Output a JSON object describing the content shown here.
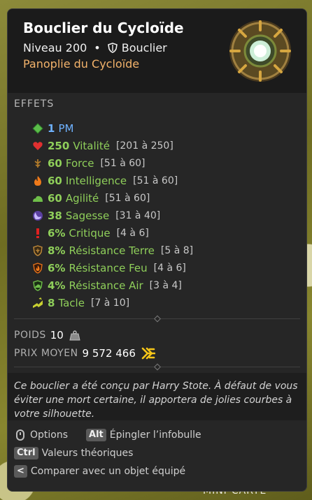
{
  "item": {
    "name": "Bouclier du Cycloïde",
    "level_text": "Niveau 200",
    "type": "Bouclier",
    "set": "Panoplie du Cycloïde"
  },
  "effects_title": "EFFETS",
  "effects": [
    {
      "icon": "pm-icon",
      "value": "1",
      "name": "PM",
      "range": ""
    },
    {
      "icon": "heart-icon",
      "value": "250",
      "name": "Vitalité",
      "range": "[201 à 250]"
    },
    {
      "icon": "force-icon",
      "value": "60",
      "name": "Force",
      "range": "[51 à 60]"
    },
    {
      "icon": "fire-icon",
      "value": "60",
      "name": "Intelligence",
      "range": "[51 à 60]"
    },
    {
      "icon": "agility-icon",
      "value": "60",
      "name": "Agilité",
      "range": "[51 à 60]"
    },
    {
      "icon": "wisdom-icon",
      "value": "38",
      "name": "Sagesse",
      "range": "[31 à 40]"
    },
    {
      "icon": "critical-icon",
      "value": "6%",
      "name": "Critique",
      "range": "[4 à 6]"
    },
    {
      "icon": "earth-resist-icon",
      "value": "8%",
      "name": "Résistance Terre",
      "range": "[5 à 8]"
    },
    {
      "icon": "fire-resist-icon",
      "value": "6%",
      "name": "Résistance Feu",
      "range": "[4 à 6]"
    },
    {
      "icon": "air-resist-icon",
      "value": "4%",
      "name": "Résistance Air",
      "range": "[3 à 4]"
    },
    {
      "icon": "tackle-icon",
      "value": "8",
      "name": "Tacle",
      "range": "[7 à 10]"
    }
  ],
  "weight": {
    "label": "POIDS",
    "value": "10"
  },
  "price": {
    "label": "PRIX MOYEN",
    "value": "9 572 466"
  },
  "description": "Ce bouclier a été conçu par Harry Stote. À défaut de vous éviter une mort certaine, il apportera de jolies courbes à votre silhouette.",
  "footer": {
    "options": "Options",
    "alt_key": "Alt",
    "pin": "Épingler l’infobulle",
    "ctrl_key": "Ctrl",
    "theoretical": "Valeurs théoriques",
    "lt_key": "<",
    "compare": "Comparer avec un objet équipé"
  },
  "background": {
    "minimap_label": "MINI-CARTE"
  },
  "colors": {
    "set": "#f3b36b",
    "effect": "#8fcf5a",
    "pm": "#6fb2ff",
    "kama": "#f5c518"
  }
}
